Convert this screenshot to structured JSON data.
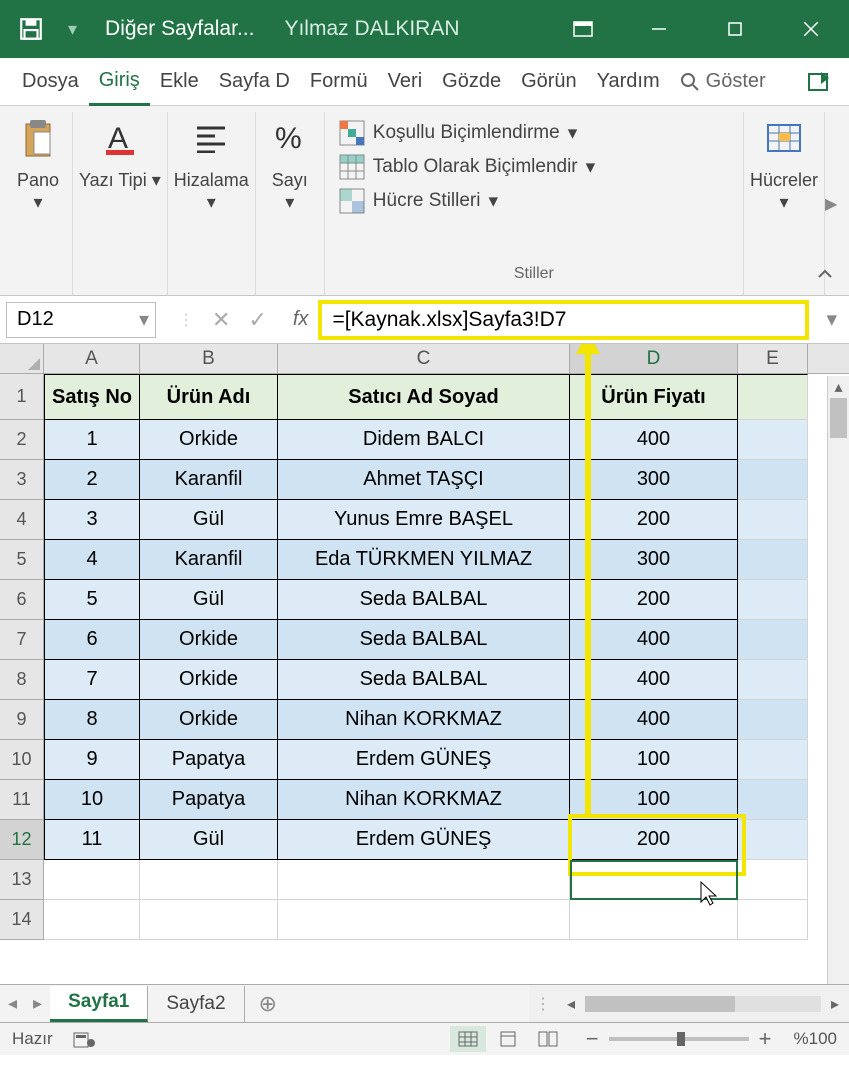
{
  "titlebar": {
    "doc_name": "Diğer Sayfalar...",
    "author": "Yılmaz DALKIRAN"
  },
  "tabs": {
    "file": "Dosya",
    "home": "Giriş",
    "insert": "Ekle",
    "layout": "Sayfa D",
    "formulas": "Formü",
    "data": "Veri",
    "review": "Gözde",
    "view": "Görün",
    "help": "Yardım",
    "tellme": "Göster"
  },
  "ribbon": {
    "clipboard": "Pano",
    "font": "Yazı Tipi",
    "alignment": "Hizalama",
    "number": "Sayı",
    "cond_format": "Koşullu Biçimlendirme",
    "table_format": "Tablo Olarak Biçimlendir",
    "cell_styles": "Hücre Stilleri",
    "styles_label": "Stiller",
    "cells": "Hücreler"
  },
  "namebox": "D12",
  "formula": "=[Kaynak.xlsx]Sayfa3!D7",
  "columns": [
    "A",
    "B",
    "C",
    "D",
    "E"
  ],
  "headers": {
    "a": "Satış No",
    "b": "Ürün Adı",
    "c": "Satıcı Ad Soyad",
    "d": "Ürün Fiyatı"
  },
  "rows": [
    {
      "n": "1",
      "a": "1",
      "b": "Orkide",
      "c": "Didem BALCI",
      "d": "400"
    },
    {
      "n": "2",
      "a": "2",
      "b": "Karanfil",
      "c": "Ahmet TAŞÇI",
      "d": "300"
    },
    {
      "n": "3",
      "a": "3",
      "b": "Gül",
      "c": "Yunus Emre BAŞEL",
      "d": "200"
    },
    {
      "n": "4",
      "a": "4",
      "b": "Karanfil",
      "c": "Eda TÜRKMEN YILMAZ",
      "d": "300"
    },
    {
      "n": "5",
      "a": "5",
      "b": "Gül",
      "c": "Seda BALBAL",
      "d": "200"
    },
    {
      "n": "6",
      "a": "6",
      "b": "Orkide",
      "c": "Seda BALBAL",
      "d": "400"
    },
    {
      "n": "7",
      "a": "7",
      "b": "Orkide",
      "c": "Seda BALBAL",
      "d": "400"
    },
    {
      "n": "8",
      "a": "8",
      "b": "Orkide",
      "c": "Nihan KORKMAZ",
      "d": "400"
    },
    {
      "n": "9",
      "a": "9",
      "b": "Papatya",
      "c": "Erdem GÜNEŞ",
      "d": "100"
    },
    {
      "n": "10",
      "a": "10",
      "b": "Papatya",
      "c": "Nihan KORKMAZ",
      "d": "100"
    },
    {
      "n": "11",
      "a": "11",
      "b": "Gül",
      "c": "Erdem GÜNEŞ",
      "d": "200"
    }
  ],
  "sheets": {
    "s1": "Sayfa1",
    "s2": "Sayfa2"
  },
  "status": {
    "ready": "Hazır",
    "zoom": "%100"
  }
}
